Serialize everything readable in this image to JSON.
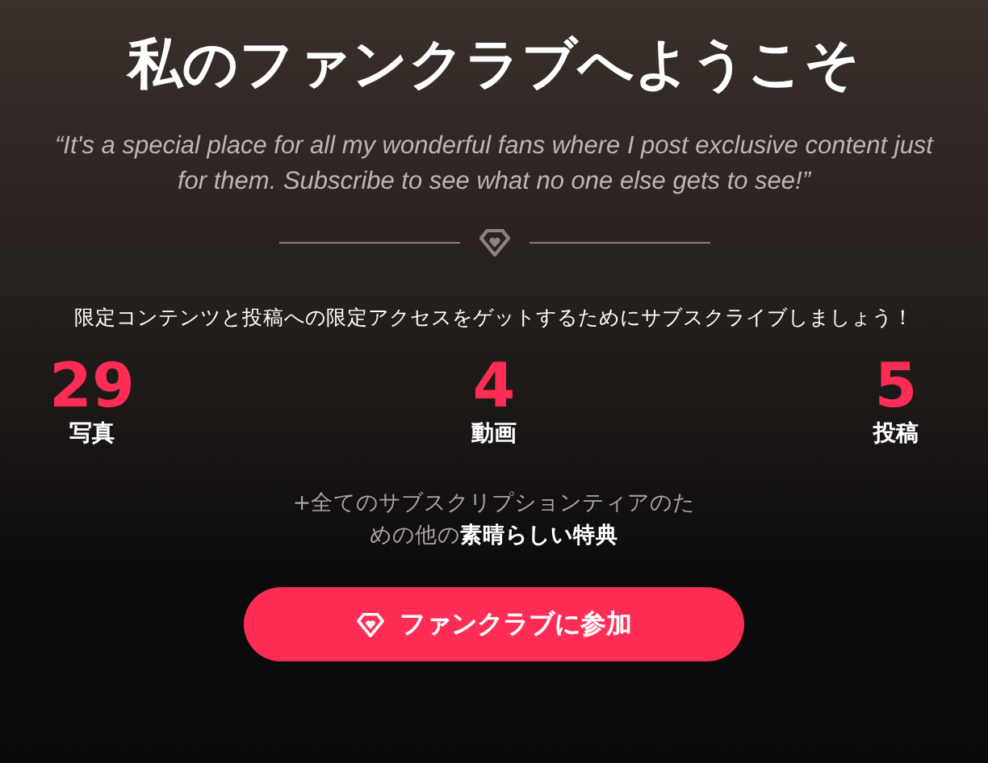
{
  "title": "私のファンクラブへようこそ",
  "quote": "“It's a special place for all my wonderful fans where I post exclusive content just for them. Subscribe to see what no one else gets to see!”",
  "intro": "限定コンテンツと投稿への限定アクセスをゲットするためにサブスクライブしましょう！",
  "stats": [
    {
      "value": "29",
      "label": "写真"
    },
    {
      "value": "4",
      "label": "動画"
    },
    {
      "value": "5",
      "label": "投稿"
    }
  ],
  "perks": "+全てのサブスクリプションティアのための他の**素晴らしい特典**",
  "join_button": "ファンクラブに参加"
}
